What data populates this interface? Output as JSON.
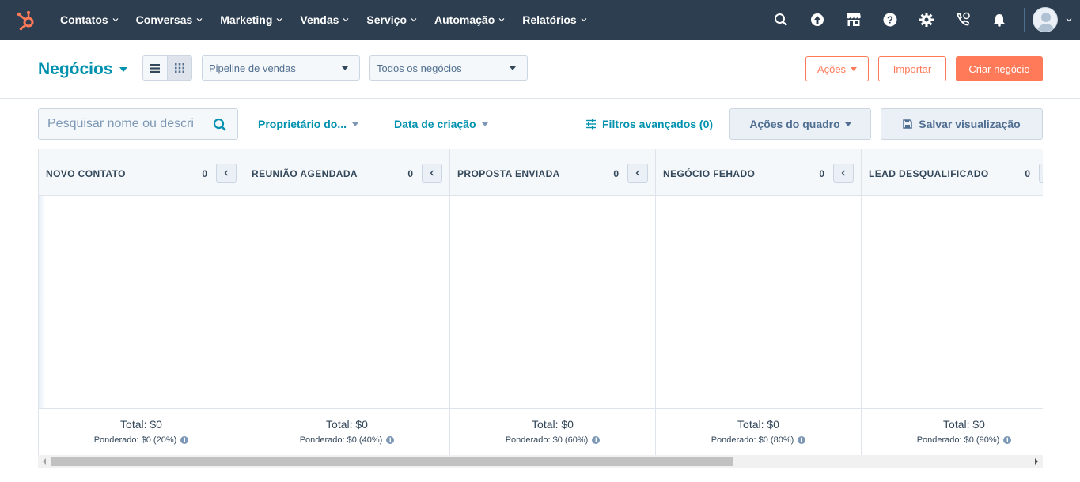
{
  "topnav": {
    "items": [
      {
        "label": "Contatos"
      },
      {
        "label": "Conversas"
      },
      {
        "label": "Marketing"
      },
      {
        "label": "Vendas"
      },
      {
        "label": "Serviço"
      },
      {
        "label": "Automação"
      },
      {
        "label": "Relatórios"
      }
    ],
    "icons": [
      "search-icon",
      "upgrade-icon",
      "marketplace-icon",
      "help-icon",
      "settings-icon",
      "calling-icon",
      "notifications-icon"
    ]
  },
  "header": {
    "title": "Negócios",
    "pipeline_select": "Pipeline de vendas",
    "deals_select": "Todos os negócios",
    "actions_label": "Ações",
    "import_label": "Importar",
    "create_label": "Criar negócio"
  },
  "filters": {
    "search_placeholder": "Pesquisar nome ou descri",
    "owner_label": "Proprietário do...",
    "created_label": "Data de criação",
    "advanced_label": "Filtros avançados (0)",
    "board_actions_label": "Ações do quadro",
    "save_view_label": "Salvar visualização"
  },
  "board": {
    "columns": [
      {
        "name": "NOVO CONTATO",
        "count": "0",
        "total": "Total: $0",
        "weighted": "Ponderado: $0 (20%)"
      },
      {
        "name": "REUNIÃO AGENDADA",
        "count": "0",
        "total": "Total: $0",
        "weighted": "Ponderado: $0 (40%)"
      },
      {
        "name": "PROPOSTA ENVIADA",
        "count": "0",
        "total": "Total: $0",
        "weighted": "Ponderado: $0 (60%)"
      },
      {
        "name": "NEGÓCIO FEHADO",
        "count": "0",
        "total": "Total: $0",
        "weighted": "Ponderado: $0 (80%)"
      },
      {
        "name": "LEAD DESQUALIFICADO",
        "count": "0",
        "total": "Total: $0",
        "weighted": "Ponderado: $0 (90%)"
      }
    ]
  },
  "colors": {
    "nav_bg": "#2d3e50",
    "accent_teal": "#0091ae",
    "accent_orange": "#ff7a59"
  }
}
